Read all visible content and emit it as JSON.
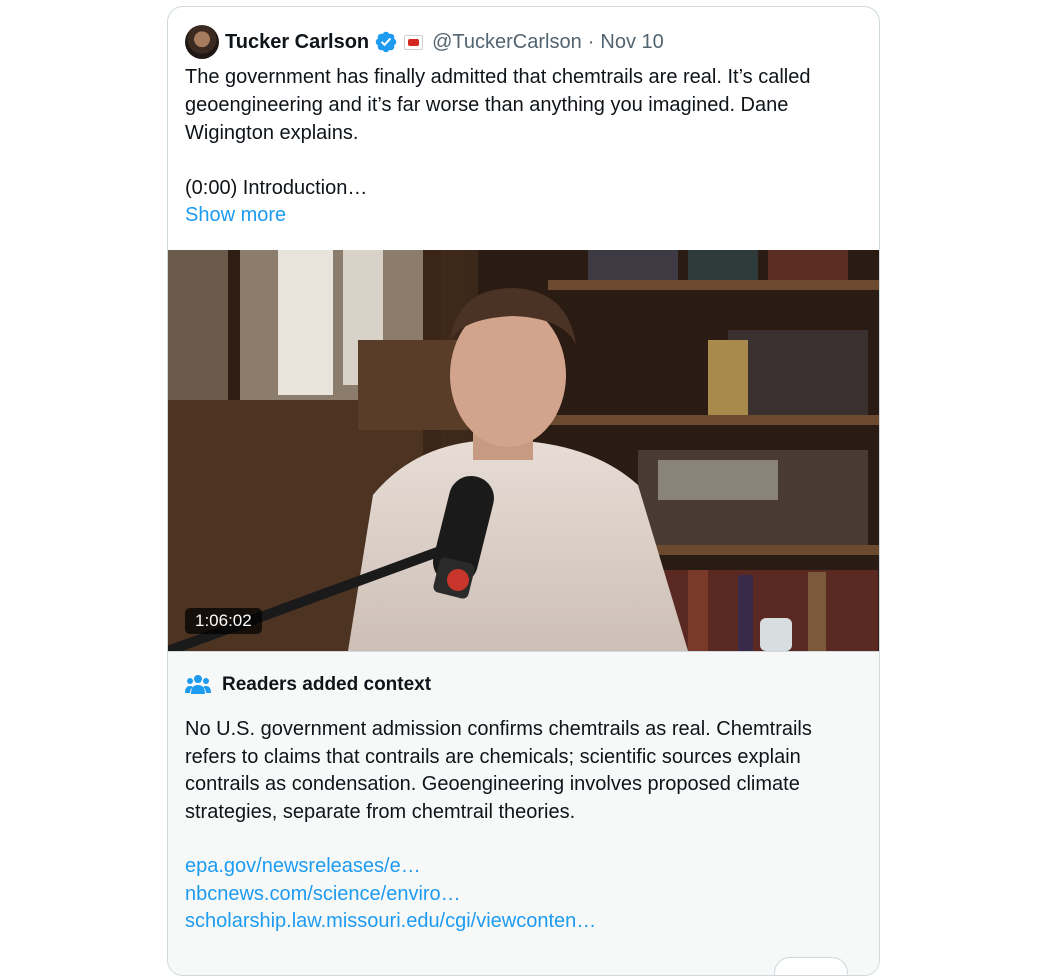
{
  "tweet": {
    "author": {
      "display_name": "Tucker Carlson",
      "handle": "@TuckerCarlson",
      "verified": true,
      "affiliate_badge": "TCN"
    },
    "separator": "·",
    "date": "Nov 10",
    "text_lines": [
      "The government has finally admitted that chemtrails are real. It’s called geoengineering and it’s far worse than anything you imagined. Dane Wigington explains.",
      "(0:00) Introduction…"
    ],
    "show_more_label": "Show more",
    "media": {
      "type": "video",
      "duration": "1:06:02"
    }
  },
  "community_note": {
    "title": "Readers added context",
    "body": "No U.S. government admission confirms chemtrails as real. Chemtrails refers to claims that contrails are chemicals; scientific sources explain contrails as condensation. Geoengineering involves proposed climate strategies, separate from chemtrail theories.",
    "links": [
      "epa.gov/newsreleases/e…",
      "nbcnews.com/science/enviro…",
      "scholarship.law.missouri.edu/cgi/viewconten…"
    ]
  },
  "colors": {
    "link_blue": "#1d9bf0",
    "secondary_text": "#536471",
    "border": "#cfd9de",
    "note_background": "#f7f9f9"
  }
}
